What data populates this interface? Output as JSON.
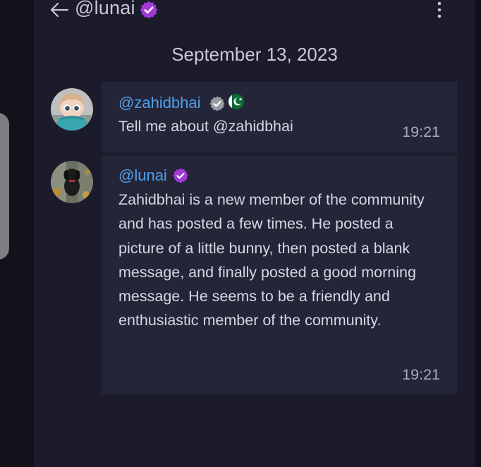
{
  "header": {
    "title": "@lunai",
    "back_icon": "arrow-left-icon",
    "verified_icon": "verified-badge-icon",
    "menu_icon": "more-vertical-icon"
  },
  "date_separator": "September 13, 2023",
  "messages": [
    {
      "username": "@zahidbhai",
      "badges": [
        "verified-badge-icon",
        "pakistan-flag-icon"
      ],
      "text": "Tell me about @zahidbhai",
      "time": "19:21"
    },
    {
      "username": "@lunai",
      "badges": [
        "verified-badge-icon"
      ],
      "text": "Zahidbhai is a new member of the community and has posted a few times. He posted a picture of a little bunny, then posted a blank message, and finally posted a good morning message. He seems to be a friendly and enthusiastic member of the community.",
      "time": "19:21"
    }
  ],
  "colors": {
    "background": "#101019",
    "panel": "#1b1b2b",
    "bubble": "#252539",
    "username": "#4fa0e8",
    "verified_purple": "#a03bd6",
    "verified_gray": "#9a9aa3"
  }
}
